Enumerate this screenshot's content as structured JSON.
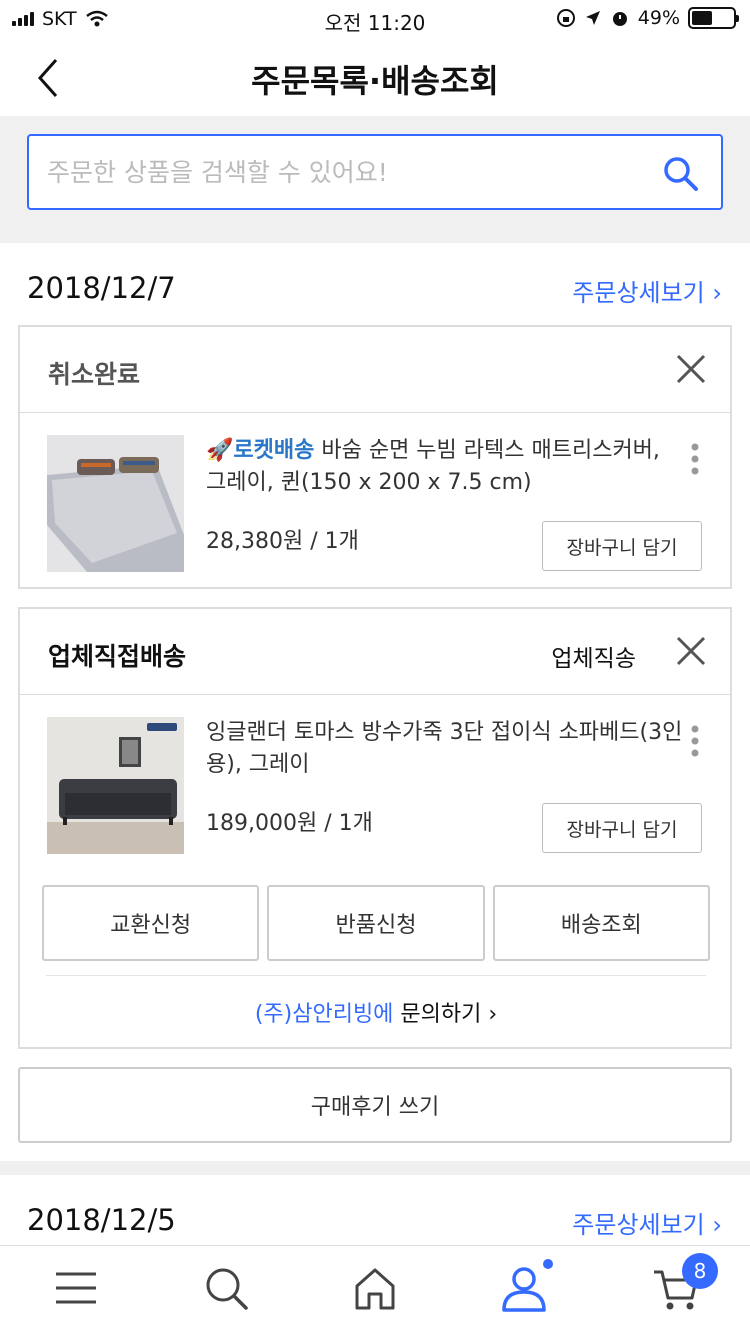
{
  "status_bar": {
    "carrier": "SKT",
    "time": "오전 11:20",
    "battery": "49%",
    "battery_level": 0.49
  },
  "header": {
    "title": "주문목록·배송조회"
  },
  "search": {
    "placeholder": "주문한 상품을 검색할 수 있어요!"
  },
  "orders": [
    {
      "date": "2018/12/7",
      "detail_link": "주문상세보기 ›",
      "groups": [
        {
          "status": "취소완료",
          "items": [
            {
              "badge": "🚀로켓배송",
              "name": " 바숨 순면 누빔 라텍스 매트리스커버, 그레이, 퀸(150 x 200 x 7.5 cm)",
              "price": "28,380원 / 1개",
              "cart_button": "장바구니 담기"
            }
          ]
        },
        {
          "status": "업체직접배송",
          "vendor_label": "업체직송",
          "items": [
            {
              "name": "잉글랜더 토마스 방수가죽 3단 접이식 소파베드(3인용), 그레이",
              "price": "189,000원 / 1개",
              "cart_button": "장바구니 담기"
            }
          ],
          "actions": [
            "교환신청",
            "반품신청",
            "배송조회"
          ],
          "inquiry": {
            "seller": "(주)삼안리빙에",
            "action": " 문의하기 ›"
          }
        }
      ],
      "review_button": "구매후기 쓰기"
    },
    {
      "date": "2018/12/5",
      "detail_link": "주문상세보기 ›"
    }
  ],
  "tabbar": {
    "items": [
      "menu-icon",
      "search-icon",
      "home-icon",
      "user-icon",
      "cart-icon"
    ],
    "cart_badge": "8"
  },
  "colors": {
    "accent": "#346aff",
    "rocket": "#2a77c8"
  }
}
